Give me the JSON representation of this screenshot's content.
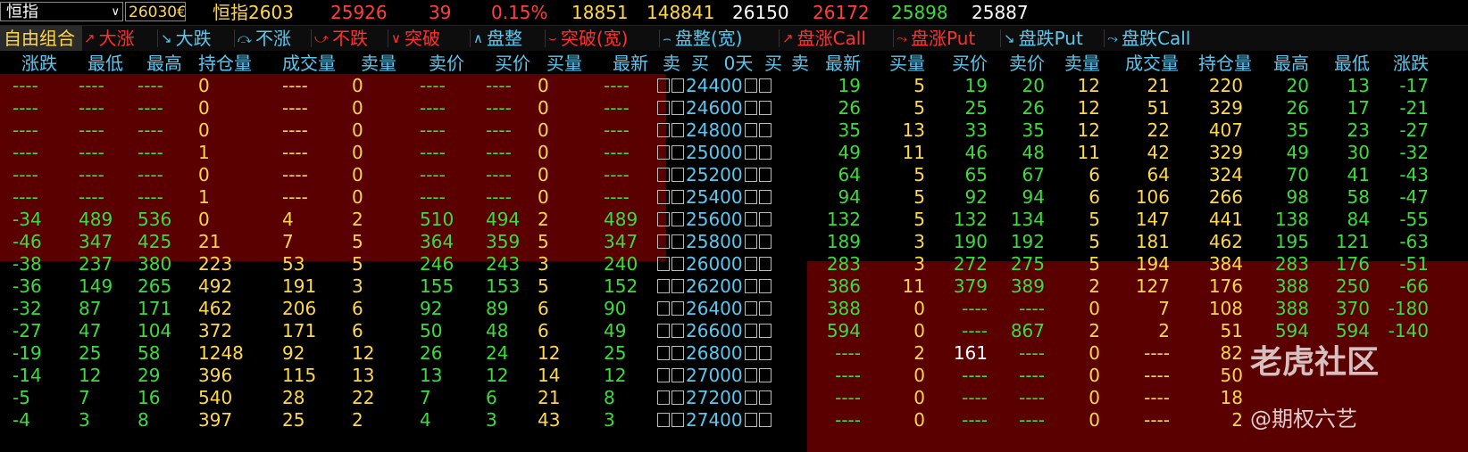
{
  "top": {
    "selector_value": "恒指",
    "code_value": "26030€",
    "contract": "恒指2603",
    "price": "25926",
    "change": "39",
    "pct": "0.15%",
    "volume": "18851",
    "open_interest": "148841",
    "v1": "26150",
    "v2": "26172",
    "v3": "25898",
    "v4": "25887"
  },
  "strategies": {
    "first": "自由组合",
    "items": [
      {
        "label": "大涨",
        "icon": "↗",
        "color": "#ff3030"
      },
      {
        "label": "大跌",
        "icon": "↘",
        "color": "#5ac8f0"
      },
      {
        "label": "不涨",
        "icon": "⤼",
        "color": "#5ac8f0"
      },
      {
        "label": "不跌",
        "icon": "⤻",
        "color": "#ff3030"
      },
      {
        "label": "突破",
        "icon": "∨",
        "color": "#ff3030"
      },
      {
        "label": "盘整",
        "icon": "∧",
        "color": "#5ac8f0"
      },
      {
        "label": "突破(宽)",
        "icon": "⌣",
        "color": "#ff3030"
      },
      {
        "label": "盘整(宽)",
        "icon": "⌢",
        "color": "#5ac8f0"
      },
      {
        "label": "盘涨Call",
        "icon": "↗",
        "color": "#ff3030"
      },
      {
        "label": "盘涨Put",
        "icon": "⤳",
        "color": "#ff3030"
      },
      {
        "label": "盘跌Put",
        "icon": "↘",
        "color": "#5ac8f0"
      },
      {
        "label": "盘跌Call",
        "icon": "⤳",
        "color": "#5ac8f0"
      }
    ]
  },
  "headers": {
    "left": [
      "涨跌",
      "最低",
      "最高",
      "持仓量",
      "成交量",
      "卖量",
      "卖价",
      "买价",
      "买量",
      "最新",
      "卖",
      "买"
    ],
    "middle": "0天",
    "right": [
      "买",
      "卖",
      "最新",
      "买量",
      "买价",
      "卖价",
      "卖量",
      "成交量",
      "持仓量",
      "最高",
      "最低",
      "涨跌"
    ]
  },
  "rows": [
    {
      "strike": "24400",
      "L": [
        "----",
        "----",
        "----",
        "0",
        "----",
        "0",
        "----",
        "----",
        "0",
        "----"
      ],
      "R": [
        "19",
        "5",
        "19",
        "20",
        "12",
        "21",
        "220",
        "20",
        "13",
        "-17"
      ]
    },
    {
      "strike": "24600",
      "L": [
        "----",
        "----",
        "----",
        "0",
        "----",
        "0",
        "----",
        "----",
        "0",
        "----"
      ],
      "R": [
        "26",
        "5",
        "25",
        "26",
        "12",
        "51",
        "329",
        "26",
        "17",
        "-21"
      ]
    },
    {
      "strike": "24800",
      "L": [
        "----",
        "----",
        "----",
        "0",
        "----",
        "0",
        "----",
        "----",
        "0",
        "----"
      ],
      "R": [
        "35",
        "13",
        "33",
        "35",
        "12",
        "22",
        "407",
        "35",
        "23",
        "-27"
      ]
    },
    {
      "strike": "25000",
      "L": [
        "----",
        "----",
        "----",
        "1",
        "----",
        "0",
        "----",
        "----",
        "0",
        "----"
      ],
      "R": [
        "49",
        "11",
        "46",
        "48",
        "11",
        "42",
        "329",
        "49",
        "30",
        "-32"
      ]
    },
    {
      "strike": "25200",
      "L": [
        "----",
        "----",
        "----",
        "0",
        "----",
        "0",
        "----",
        "----",
        "0",
        "----"
      ],
      "R": [
        "64",
        "5",
        "65",
        "67",
        "6",
        "64",
        "324",
        "70",
        "41",
        "-43"
      ]
    },
    {
      "strike": "25400",
      "L": [
        "----",
        "----",
        "----",
        "1",
        "----",
        "0",
        "----",
        "----",
        "0",
        "----"
      ],
      "R": [
        "94",
        "5",
        "92",
        "94",
        "6",
        "106",
        "266",
        "98",
        "58",
        "-47"
      ]
    },
    {
      "strike": "25600",
      "L": [
        "-34",
        "489",
        "536",
        "0",
        "4",
        "2",
        "510",
        "494",
        "2",
        "489"
      ],
      "R": [
        "132",
        "5",
        "132",
        "134",
        "5",
        "147",
        "441",
        "138",
        "84",
        "-55"
      ]
    },
    {
      "strike": "25800",
      "L": [
        "-46",
        "347",
        "425",
        "21",
        "7",
        "5",
        "364",
        "359",
        "5",
        "347"
      ],
      "R": [
        "189",
        "3",
        "190",
        "192",
        "5",
        "181",
        "462",
        "195",
        "121",
        "-63"
      ]
    },
    {
      "strike": "26000",
      "L": [
        "-38",
        "237",
        "380",
        "223",
        "53",
        "5",
        "246",
        "243",
        "3",
        "240"
      ],
      "R": [
        "283",
        "3",
        "272",
        "275",
        "5",
        "194",
        "384",
        "283",
        "176",
        "-51"
      ]
    },
    {
      "strike": "26200",
      "L": [
        "-36",
        "149",
        "265",
        "492",
        "191",
        "3",
        "155",
        "153",
        "5",
        "152"
      ],
      "R": [
        "386",
        "11",
        "379",
        "389",
        "2",
        "127",
        "176",
        "388",
        "250",
        "-66"
      ]
    },
    {
      "strike": "26400",
      "L": [
        "-32",
        "87",
        "171",
        "462",
        "206",
        "6",
        "92",
        "89",
        "6",
        "90"
      ],
      "R": [
        "388",
        "0",
        "----",
        "----",
        "0",
        "7",
        "108",
        "388",
        "370",
        "-180"
      ]
    },
    {
      "strike": "26600",
      "L": [
        "-27",
        "47",
        "104",
        "372",
        "171",
        "6",
        "50",
        "48",
        "6",
        "49"
      ],
      "R": [
        "594",
        "0",
        "----",
        "867",
        "2",
        "2",
        "51",
        "594",
        "594",
        "-140"
      ]
    },
    {
      "strike": "26800",
      "L": [
        "-19",
        "25",
        "58",
        "1248",
        "92",
        "12",
        "26",
        "24",
        "12",
        "25"
      ],
      "R": [
        "----",
        "2",
        "161",
        "----",
        "0",
        "----",
        "82",
        "",
        "",
        ""
      ]
    },
    {
      "strike": "27000",
      "L": [
        "-14",
        "12",
        "29",
        "396",
        "115",
        "13",
        "13",
        "12",
        "14",
        "12"
      ],
      "R": [
        "----",
        "0",
        "----",
        "----",
        "0",
        "----",
        "50",
        "",
        "",
        ""
      ]
    },
    {
      "strike": "27200",
      "L": [
        "-5",
        "7",
        "16",
        "540",
        "28",
        "22",
        "7",
        "6",
        "21",
        "8"
      ],
      "R": [
        "----",
        "0",
        "----",
        "----",
        "0",
        "----",
        "18",
        "",
        "",
        ""
      ]
    },
    {
      "strike": "27400",
      "L": [
        "-4",
        "3",
        "8",
        "397",
        "25",
        "2",
        "4",
        "3",
        "43",
        "3"
      ],
      "R": [
        "----",
        "0",
        "----",
        "----",
        "0",
        "----",
        "2",
        "",
        "",
        ""
      ]
    }
  ],
  "watermark": {
    "brand": "老虎社区",
    "author": "@期权六艺"
  },
  "colors": {
    "itm_bg": "#5a0000",
    "header": "#5ac8f0",
    "yellow": "#ffd84a",
    "green": "#3cdc3c",
    "red": "#ff4040",
    "white": "#ffffff"
  }
}
